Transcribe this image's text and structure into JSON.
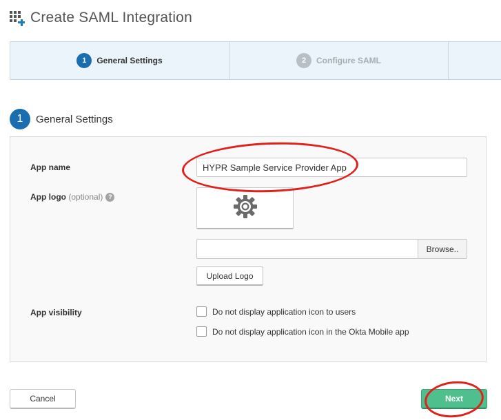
{
  "header": {
    "title": "Create SAML Integration",
    "icon": "grid-add-icon"
  },
  "wizard": {
    "steps": [
      {
        "number": "1",
        "label": "General Settings",
        "state": "active"
      },
      {
        "number": "2",
        "label": "Configure SAML",
        "state": "inactive"
      }
    ]
  },
  "section": {
    "number": "1",
    "title": "General Settings"
  },
  "form": {
    "app_name": {
      "label": "App name",
      "value": "HYPR Sample Service Provider App"
    },
    "app_logo": {
      "label": "App logo",
      "optional_text": "(optional)",
      "help_icon_text": "?",
      "logo_icon": "gear-icon",
      "file_path_value": "",
      "browse_label": "Browse..",
      "upload_label": "Upload Logo"
    },
    "app_visibility": {
      "label": "App visibility",
      "options": [
        {
          "label": "Do not display application icon to users",
          "checked": false
        },
        {
          "label": "Do not display application icon in the Okta Mobile app",
          "checked": false
        }
      ]
    }
  },
  "footer": {
    "cancel_label": "Cancel",
    "next_label": "Next"
  },
  "colors": {
    "accent_blue": "#1a6eb0",
    "next_green": "#4fbf8e",
    "annotation_red": "#e0201b"
  }
}
